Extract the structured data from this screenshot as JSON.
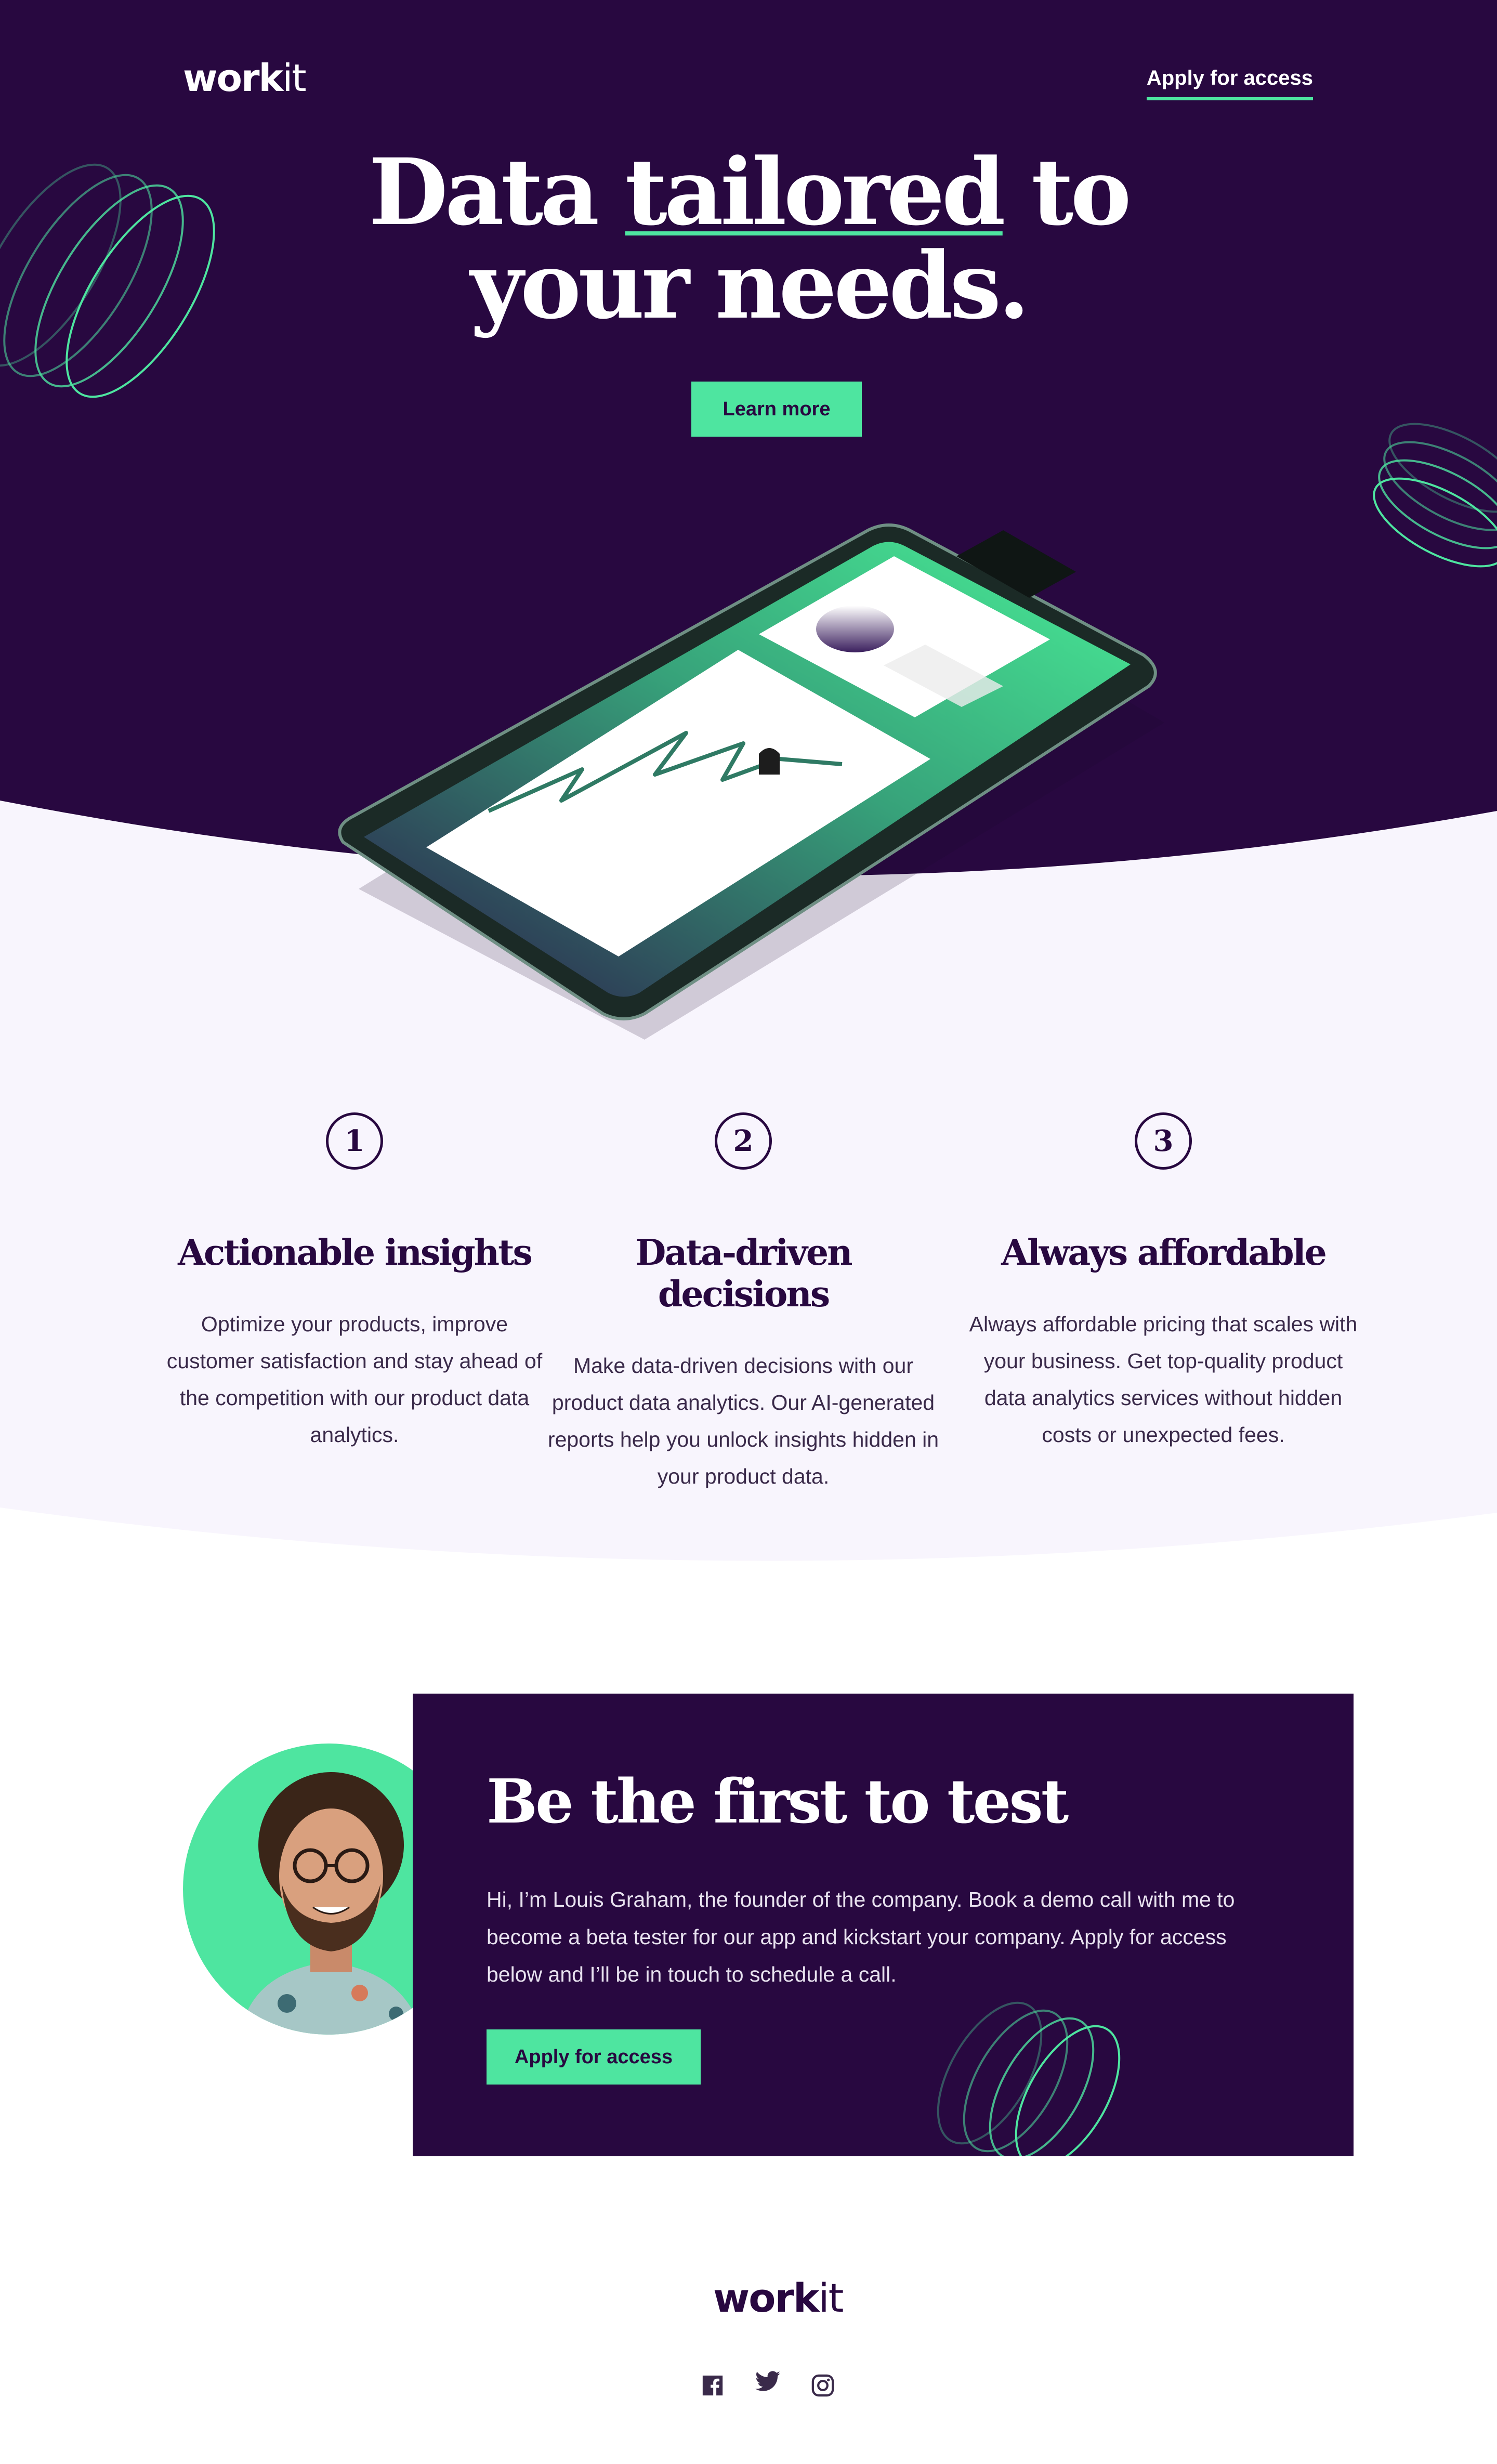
{
  "header": {
    "logo_bold": "work",
    "logo_light": "it",
    "apply_link": "Apply for access"
  },
  "hero": {
    "headline_part1": "Data ",
    "headline_underlined": "tailored",
    "headline_part2": " to",
    "headline_line2": "your needs.",
    "cta_label": "Learn more"
  },
  "features": [
    {
      "number": "1",
      "title": "Actionable insights",
      "text": "Optimize your products, improve customer satisfaction and stay ahead of the competition with our product data analytics."
    },
    {
      "number": "2",
      "title": "Data-driven decisions",
      "text": "Make data-driven decisions with our product data analytics. Our AI-generated reports help you unlock insights hidden in your product data."
    },
    {
      "number": "3",
      "title": "Always affordable",
      "text": "Always affordable pricing that scales with your business. Get top-quality product data analytics services without hidden costs or unexpected fees."
    }
  ],
  "cta": {
    "title": "Be the first to test",
    "text": "Hi, I’m Louis Graham, the founder of the company. Book a demo call with me to become a beta tester for our app and kickstart your company. Apply for access below and I’ll be in touch to schedule a call.",
    "button_label": "Apply for access"
  },
  "footer": {
    "logo_bold": "work",
    "logo_light": "it",
    "social_icons": [
      "facebook-icon",
      "twitter-icon",
      "instagram-icon"
    ]
  },
  "colors": {
    "brand_dark": "#280840",
    "accent_green": "#4ee5a0",
    "light_bg": "#f8f5fd"
  }
}
